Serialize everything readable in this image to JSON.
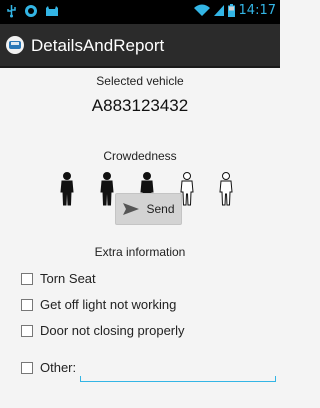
{
  "status_bar": {
    "time": "14:17",
    "left_icons": [
      "usb-icon",
      "sync-icon",
      "cat-icon"
    ],
    "right_icons": [
      "wifi-icon",
      "signal-icon",
      "battery-icon"
    ]
  },
  "action_bar": {
    "title": "DetailsAndReport",
    "icon": "bus-app-icon"
  },
  "vehicle": {
    "label": "Selected vehicle",
    "id": "A883123432"
  },
  "crowdedness": {
    "label": "Crowdedness",
    "level": 3,
    "max": 5
  },
  "send": {
    "label": "Send",
    "icon": "send-arrow-icon"
  },
  "extra": {
    "label": "Extra information",
    "options": [
      {
        "label": "Torn Seat",
        "checked": false
      },
      {
        "label": "Get off light not working",
        "checked": false
      },
      {
        "label": "Door not closing properly",
        "checked": false
      },
      {
        "label": "Other:",
        "checked": false
      }
    ],
    "other_value": ""
  },
  "colors": {
    "accent": "#33b5e5",
    "action_bar": "#2b2b2b",
    "background": "#f4f4f4"
  }
}
